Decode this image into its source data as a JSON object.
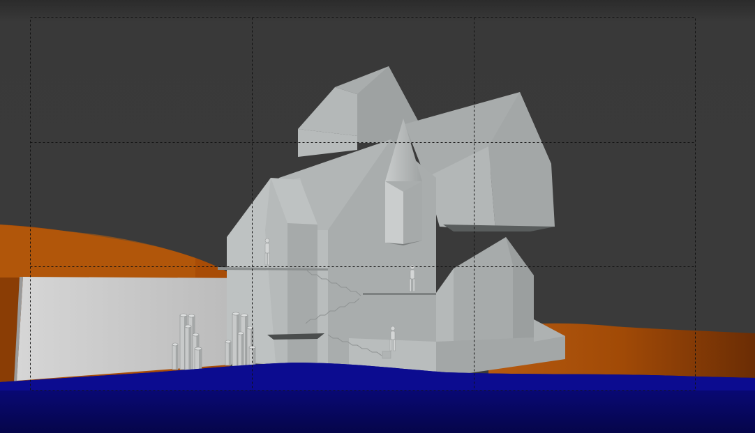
{
  "viewport": {
    "colors": {
      "background_top": "#2a2a2a",
      "background_mid": "#3a3a3a",
      "terrain_orange": "#b45309",
      "terrain_orange_dark": "#7a3508",
      "water": "#0a0a8a",
      "water_dark": "#05054f",
      "building_light": "#bfc3c3",
      "building_mid": "#a7abab",
      "building_dark": "#8f9393",
      "wall": "#c7c7c7",
      "guide_lines": "#111111"
    },
    "elements": {
      "camera_frame": "camera-frame",
      "thirds_grid": "rule-of-thirds-grid",
      "terrain": "orange-terrain",
      "water": "blue-water-plane",
      "building": "gray-house-model",
      "wall": "retaining-wall",
      "cylinders_left": "cylinder-cluster-left",
      "cylinders_right": "cylinder-cluster-right",
      "stairs": "staircase",
      "figures": "human-figures"
    }
  }
}
